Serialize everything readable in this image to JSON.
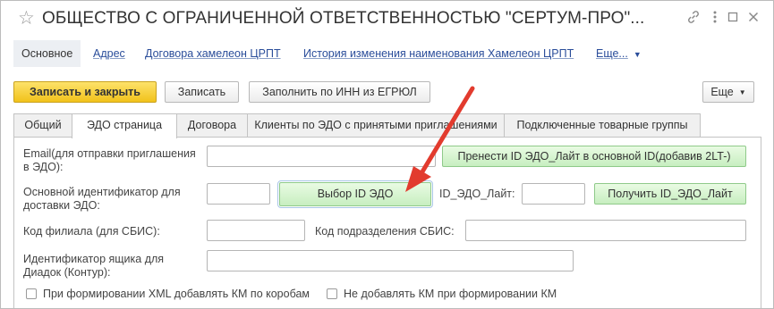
{
  "window": {
    "title": "ОБЩЕСТВО С ОГРАНИЧЕННОЙ ОТВЕТСТВЕННОСТЬЮ \"СЕРТУМ-ПРО\"..."
  },
  "nav": {
    "items": [
      {
        "label": "Основное"
      },
      {
        "label": "Адрес"
      },
      {
        "label": "Договора хамелеон ЦРПТ"
      },
      {
        "label": "История изменения наименования Хамелеон ЦРПТ"
      }
    ],
    "more_label": "Еще..."
  },
  "toolbar": {
    "save_close_label": "Записать и закрыть",
    "save_label": "Записать",
    "fill_inn_label": "Заполнить по ИНН из ЕГРЮЛ",
    "more_label": "Еще"
  },
  "tabs": [
    {
      "label": "Общий"
    },
    {
      "label": "ЭДО страница"
    },
    {
      "label": "Договора"
    },
    {
      "label": "Клиенты по ЭДО с принятыми приглашениями"
    },
    {
      "label": "Подключенные товарные группы"
    }
  ],
  "form": {
    "email_label_1": "Email(для отправки приглашения",
    "email_label_2": "в ЭДО):",
    "email_value": "",
    "move_id_button": "Пренести ID ЭДО_Лайт в основной ID(добавив 2LT-)",
    "main_id_label_1": "Основной идентификатор для",
    "main_id_label_2": "доставки ЭДО:",
    "main_id_value": "",
    "select_id_button": "Выбор ID ЭДО",
    "lite_id_label": "ID_ЭДО_Лайт:",
    "lite_id_value": "",
    "get_lite_id_button": "Получить ID_ЭДО_Лайт",
    "branch_code_label": "Код филиала (для СБИС):",
    "branch_code_value": "",
    "division_code_label": "Код подразделения СБИС:",
    "division_code_value": "",
    "diadoc_label_1": "Идентификатор ящика для",
    "diadoc_label_2": "Диадок (Контур):",
    "diadoc_value": "",
    "checkbox_km_boxes": {
      "label": "При формировании XML добавлять КМ по коробам",
      "checked": false
    },
    "checkbox_no_km": {
      "label": "Не добавлять КМ при формировании КМ",
      "checked": false
    }
  },
  "colors": {
    "primary_button": "#f5c928",
    "green_button": "#c7eec0",
    "link": "#2a4d9a",
    "annotation_arrow": "#e23b2e"
  }
}
